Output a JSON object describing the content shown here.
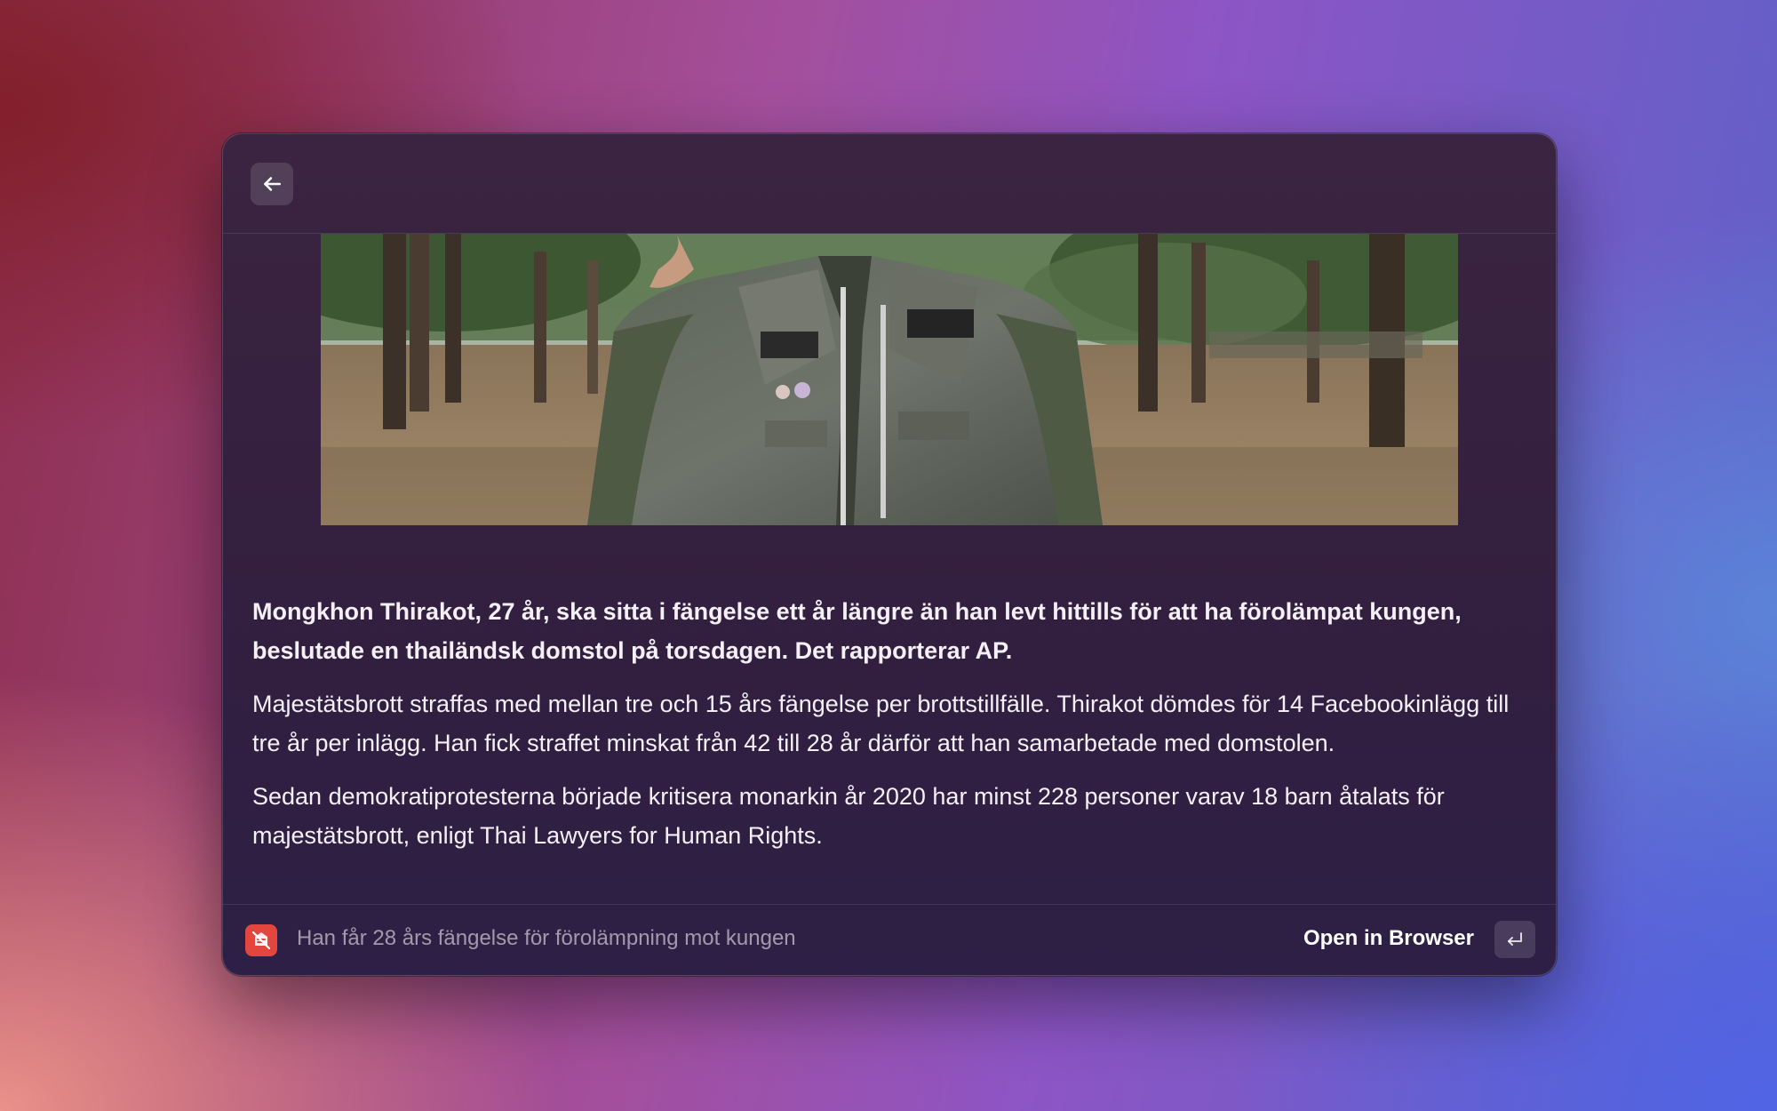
{
  "header": {
    "back_icon": "arrow-left-icon"
  },
  "article": {
    "image": "photo of a man in a studded denim jacket in a park",
    "paragraphs": [
      "Mongkhon Thirakot, 27 år, ska sitta i fängelse ett år längre än han levt hittills för att ha förolämpat kungen, beslutade en thailändsk domstol på torsdagen. Det rapporterar AP.",
      "Majestätsbrott straffas med mellan tre och 15 års fängelse per brottstillfälle. Thirakot dömdes för 14 Facebookinlägg till tre år per inlägg. Han fick straffet minskat från 42 till 28 år därför att han samarbetade med domstolen.",
      "Sedan demokratiprotesterna började kritisera monarkin år 2020 har minst 228 personer varav 18 barn åtalats för majestätsbrott, enligt Thai Lawyers for Human Rights."
    ]
  },
  "footer": {
    "app_icon": "news-app-icon",
    "title": "Han får 28 års fängelse för förolämpning mot kungen",
    "open_label": "Open in Browser",
    "enter_icon": "return-key-icon"
  },
  "colors": {
    "window_bg": "#36213f",
    "app_icon_bg": "#e2463f",
    "text": "#f5f0f6"
  }
}
